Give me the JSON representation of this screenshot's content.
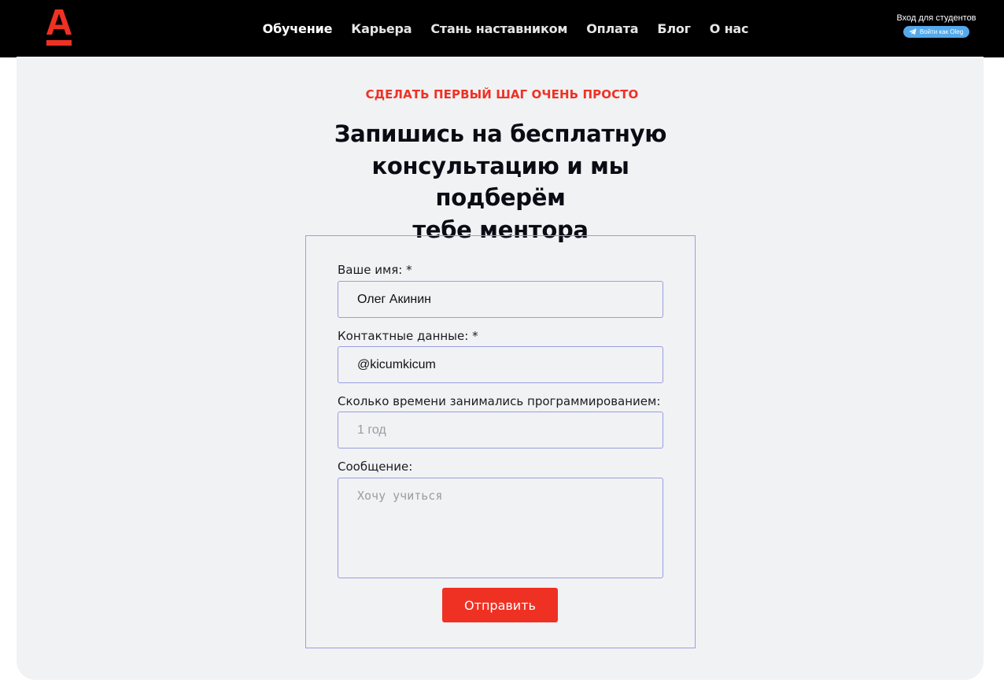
{
  "header": {
    "logo_icon": "alfa-logo-icon",
    "brand_color": "#ef3124",
    "nav": [
      {
        "label": "Обучение",
        "active": true
      },
      {
        "label": "Карьера",
        "active": false
      },
      {
        "label": "Стань наставником",
        "active": false
      },
      {
        "label": "Оплата",
        "active": false
      },
      {
        "label": "Блог",
        "active": false
      },
      {
        "label": "О нас",
        "active": false
      }
    ],
    "student_login": {
      "title": "Вход для студентов",
      "telegram_button": "Войти как Oleg",
      "telegram_icon": "telegram-icon",
      "telegram_color": "#54a9eb"
    }
  },
  "main": {
    "kicker": "СДЕЛАТЬ ПЕРВЫЙ ШАГ ОЧЕНЬ ПРОСТО",
    "heading_lines": [
      "Запишись на бесплатную",
      "консультацию и мы подберём",
      "тебе ментора"
    ]
  },
  "form": {
    "name": {
      "label": "Ваше имя: *",
      "value": "Олег Акинин"
    },
    "contact": {
      "label": "Контактные данные: *",
      "value": "@kicumkicum"
    },
    "experience": {
      "label": "Сколько времени занимались программированием:",
      "value": "",
      "placeholder": "1 год"
    },
    "message": {
      "label": "Сообщение:",
      "value": "",
      "placeholder": "Хочу учиться"
    },
    "submit_label": "Отправить"
  }
}
